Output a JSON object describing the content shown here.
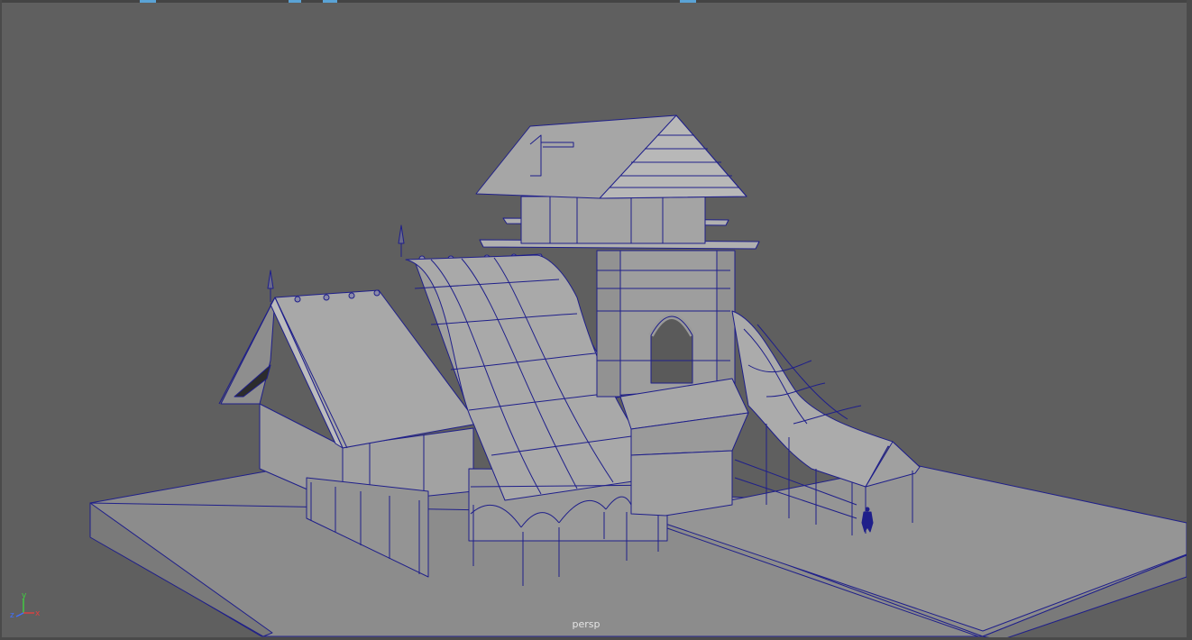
{
  "viewport": {
    "camera": "persp",
    "background": "#5f5f5f",
    "wire_color": "#1f1f8a",
    "surface_color": "#9a9a9a"
  },
  "axis_gizmo": {
    "x": "x",
    "y": "y",
    "z": "z",
    "x_color": "#e04040",
    "y_color": "#40d040",
    "z_color": "#4070ff"
  }
}
